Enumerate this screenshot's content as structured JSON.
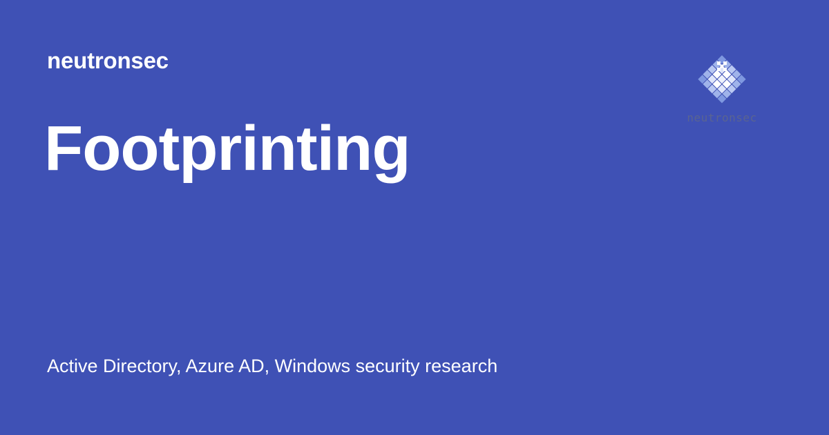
{
  "site": {
    "name": "neutronsec"
  },
  "page": {
    "title": "Footprinting",
    "subtitle": "Active Directory, Azure AD, Windows security research"
  },
  "logo": {
    "icon": "diamond-grid-logo-icon",
    "wordmark": "neutronsec",
    "colors": [
      "#8fa6e8",
      "#b7c6f2",
      "#dfe6fb",
      "#ffffff"
    ]
  },
  "colors": {
    "background": "#3f51b5",
    "text": "#ffffff",
    "logo_wordmark": "#5a6491"
  }
}
